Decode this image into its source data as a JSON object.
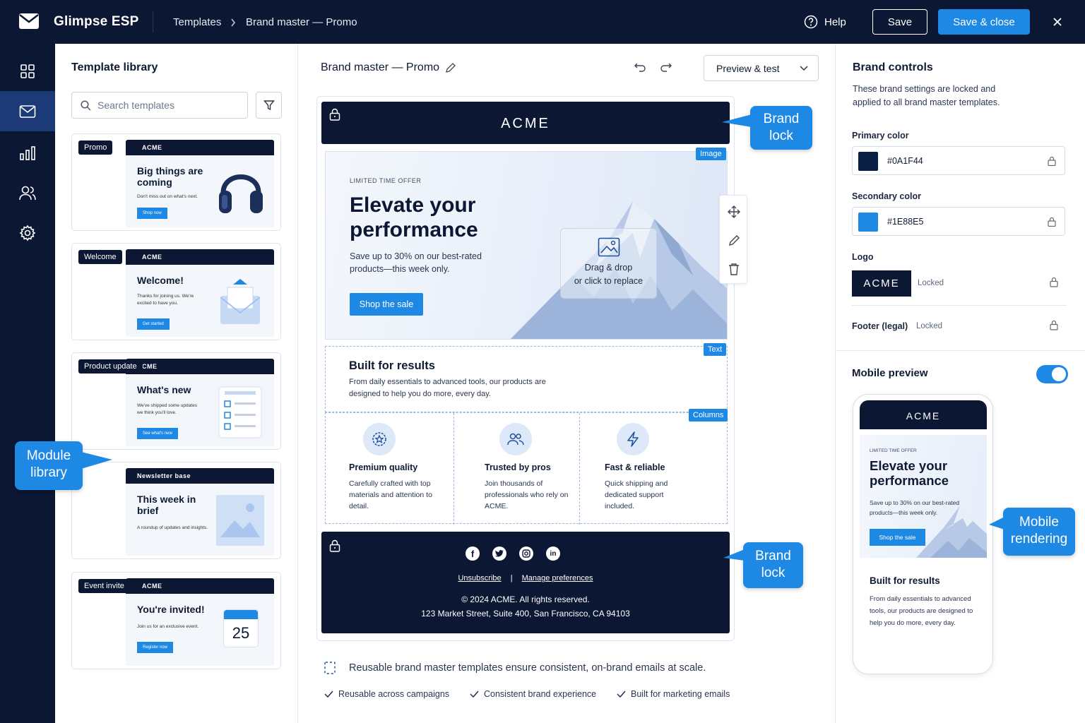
{
  "app": {
    "name": "Glimpse ESP"
  },
  "breadcrumb": {
    "root": "Templates",
    "current": "Brand master — Promo"
  },
  "topbar": {
    "help": "Help",
    "save": "Save",
    "save_close": "Save & close"
  },
  "sidebar": {
    "items": [
      "templates-grid",
      "email",
      "analytics",
      "audience",
      "settings"
    ],
    "active": "email"
  },
  "library": {
    "title": "Template library",
    "search_placeholder": "Search templates",
    "templates": [
      {
        "badge": "Promo",
        "brand": "ACME",
        "heading": "Big things are coming",
        "sub": "Don't miss out on what's next.",
        "button": "Shop now"
      },
      {
        "badge": "Welcome",
        "brand": "ACME",
        "heading": "Welcome!",
        "sub": "Thanks for joining us. We're excited to have you.",
        "button": "Get started"
      },
      {
        "badge": "Product update",
        "brand": "CME",
        "heading": "What's new",
        "sub": "We've shipped some updates we think you'll love.",
        "button": "See what's new"
      },
      {
        "badge": "",
        "brand": "Newsletter base",
        "heading": "This week in brief",
        "sub": "A roundup of updates and insights.",
        "button": ""
      },
      {
        "badge": "Event invite",
        "brand": "ACME",
        "heading": "You're invited!",
        "sub": "Join us for an exclusive event.",
        "button": "Register now",
        "calendar_day": "25"
      }
    ]
  },
  "callouts": {
    "module_library": "Module library",
    "brand_lock_top": "Brand lock",
    "brand_lock_bottom": "Brand lock",
    "mobile_rendering": "Mobile rendering"
  },
  "canvas": {
    "title": "Brand master — Promo",
    "preview_dropdown": "Preview & test",
    "email": {
      "brand": "ACME",
      "image_tag": "Image",
      "hero": {
        "kicker": "LIMITED TIME OFFER",
        "heading": "Elevate your performance",
        "sub": "Save up to 30% on our best-rated products—this week only.",
        "cta": "Shop the sale",
        "drop_hint_1": "Drag & drop",
        "drop_hint_2": "or click to replace"
      },
      "text_tag": "Text",
      "text_block": {
        "heading": "Built for results",
        "body": "From daily essentials to advanced tools, our products are designed to help you do more, every day."
      },
      "columns_tag": "Columns",
      "columns": [
        {
          "icon": "badge-star-icon",
          "heading": "Premium quality",
          "body": "Carefully crafted with top materials and attention to detail."
        },
        {
          "icon": "users-icon",
          "heading": "Trusted by pros",
          "body": "Join thousands of professionals who rely on ACME."
        },
        {
          "icon": "bolt-icon",
          "heading": "Fast & reliable",
          "body": "Quick shipping and dedicated support included."
        }
      ],
      "footer": {
        "unsubscribe": "Unsubscribe",
        "manage": "Manage preferences",
        "copyright": "© 2024 ACME. All rights reserved.",
        "address": "123 Market Street, Suite 400, San Francisco, CA 94103"
      }
    },
    "note": "Reusable brand master templates ensure consistent, on-brand emails at scale.",
    "checks": [
      "Reusable across campaigns",
      "Consistent brand experience",
      "Built for marketing emails"
    ]
  },
  "brand_controls": {
    "title": "Brand controls",
    "desc": "These brand settings are locked and applied to all brand master templates.",
    "primary_label": "Primary color",
    "primary_hex": "#0A1F44",
    "secondary_label": "Secondary color",
    "secondary_hex": "#1E88E5",
    "logo_label": "Logo",
    "logo_text": "ACME",
    "logo_status": "Locked",
    "footer_label": "Footer (legal)",
    "footer_status": "Locked"
  },
  "mobile": {
    "title": "Mobile preview",
    "enabled": true,
    "brand": "ACME",
    "kicker": "LIMITED TIME OFFER",
    "heading": "Elevate your performance",
    "sub": "Save up to 30% on our best-rated products—this week only.",
    "cta": "Shop the sale",
    "text_heading": "Built for results",
    "text_body": "From daily essentials to advanced tools, our products are designed to help you do more, every day."
  },
  "colors": {
    "navy": "#0b1733",
    "accent": "#1e88e5"
  }
}
